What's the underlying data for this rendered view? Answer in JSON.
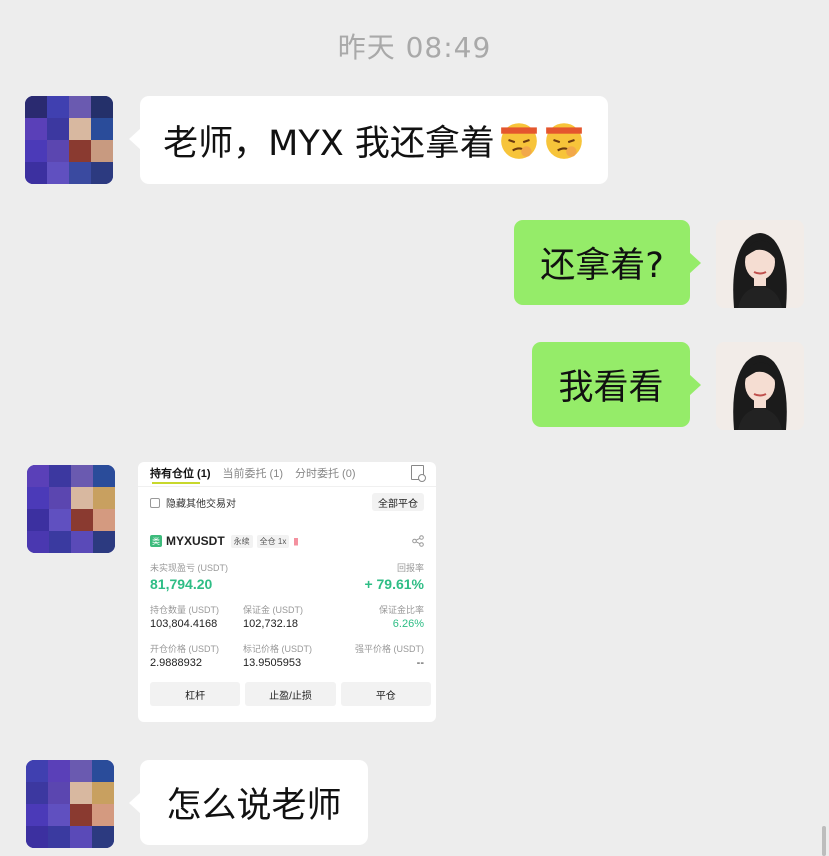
{
  "timestamp": "昨天 08:49",
  "messages": [
    {
      "side": "left",
      "text": "老师，MYX 我还拿着",
      "emoji": "face-with-headband-icon"
    },
    {
      "side": "right",
      "text": "还拿着?"
    },
    {
      "side": "right",
      "text": "我看看"
    },
    {
      "side": "left",
      "type": "image"
    },
    {
      "side": "left",
      "text": "怎么说老师"
    }
  ],
  "card": {
    "tabs": [
      "持有仓位 (1)",
      "当前委托 (1)",
      "分时委托 (0)"
    ],
    "hide_other_pairs": "隐藏其他交易对",
    "close_all": "全部平仓",
    "symbol": "MYXUSDT",
    "symbol_icon": "类",
    "tag_perpetual": "永续",
    "tag_margin": "全仓 1x",
    "bars": "||||",
    "unrealized_pnl_label": "未实现盈亏 (USDT)",
    "unrealized_pnl": "81,794.20",
    "roe_label": "回报率",
    "roe": "+ 79.61%",
    "position_size_label": "持仓数量 (USDT)",
    "position_size": "103,804.4168",
    "margin_label": "保证金 (USDT)",
    "margin": "102,732.18",
    "margin_ratio_label": "保证金比率",
    "margin_ratio": "6.26%",
    "entry_price_label": "开仓价格 (USDT)",
    "entry_price": "2.9888932",
    "mark_price_label": "标记价格 (USDT)",
    "mark_price": "13.9505953",
    "liq_price_label": "强平价格 (USDT)",
    "liq_price": "--",
    "buttons": [
      "杠杆",
      "止盈/止损",
      "平仓"
    ]
  },
  "colors": {
    "background": "#ededed",
    "bubble_self": "#95ec69",
    "bubble_other": "#ffffff",
    "profit_green": "#2ebd85"
  }
}
